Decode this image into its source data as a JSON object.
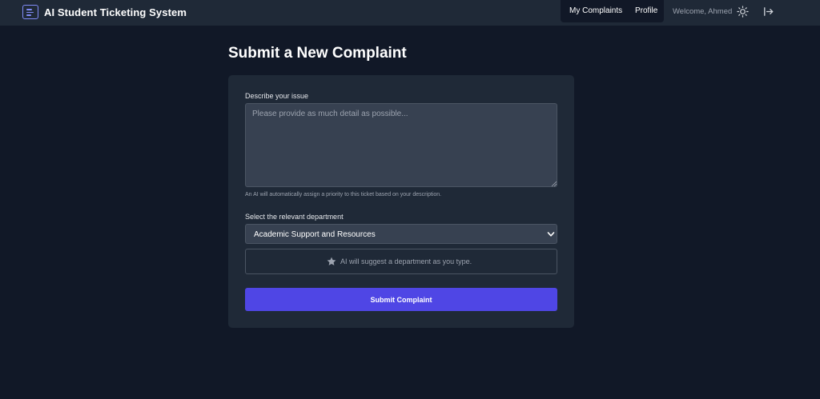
{
  "app": {
    "title": "AI Student Ticketing System",
    "accent_color": "#4f46e5",
    "brand_icon": "document-lines-icon"
  },
  "nav": {
    "my_complaints": "My Complaints",
    "profile": "Profile",
    "welcome": "Welcome, Ahmed",
    "theme_icon": "sun-icon",
    "logout_icon": "logout-icon"
  },
  "main": {
    "page_title": "Submit a New Complaint"
  },
  "form": {
    "issue_label": "Describe your issue",
    "issue_placeholder": "Please provide as much detail as possible...",
    "issue_value": "",
    "issue_hint": "An AI will automatically assign a priority to this ticket based on your description.",
    "department_label": "Select the relevant department",
    "department_selected": "Academic Support and Resources",
    "suggestion_icon": "star-icon",
    "suggestion_text": "AI will suggest a department as you type.",
    "submit_label": "Submit Complaint"
  }
}
